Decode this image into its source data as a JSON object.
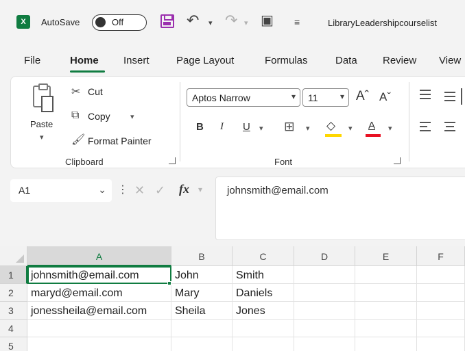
{
  "titlebar": {
    "app_icon": "X",
    "autosave_label": "AutoSave",
    "autosave_state": "Off",
    "document_title": "LibraryLeadershipcourselist"
  },
  "menu": {
    "tabs": [
      "File",
      "Home",
      "Insert",
      "Page Layout",
      "Formulas",
      "Data",
      "Review",
      "View"
    ],
    "active_tab": "Home"
  },
  "ribbon": {
    "clipboard": {
      "paste_label": "Paste",
      "cut_label": "Cut",
      "copy_label": "Copy",
      "format_painter_label": "Format Painter",
      "group_label": "Clipboard"
    },
    "font": {
      "font_name": "Aptos Narrow",
      "font_size": "11",
      "bold": "B",
      "italic": "I",
      "underline": "U",
      "font_color_letter": "A",
      "group_label": "Font",
      "highlight_color": "#ffd700",
      "font_color": "#e81123"
    }
  },
  "formula_bar": {
    "name_box": "A1",
    "fx_label": "fx",
    "content": "johnsmith@email.com"
  },
  "grid": {
    "columns": [
      "A",
      "B",
      "C",
      "D",
      "E",
      "F"
    ],
    "rows": [
      "1",
      "2",
      "3",
      "4",
      "5"
    ],
    "cells": [
      [
        "johnsmith@email.com",
        "John",
        "Smith",
        "",
        "",
        ""
      ],
      [
        "maryd@email.com",
        "Mary",
        "Daniels",
        "",
        "",
        ""
      ],
      [
        "jonessheila@email.com",
        "Sheila",
        "Jones",
        "",
        "",
        ""
      ],
      [
        "",
        "",
        "",
        "",
        "",
        ""
      ],
      [
        "",
        "",
        "",
        "",
        "",
        ""
      ]
    ],
    "active_cell": "A1"
  },
  "colors": {
    "accent": "#107c41",
    "save_icon": "#9b2fae"
  }
}
